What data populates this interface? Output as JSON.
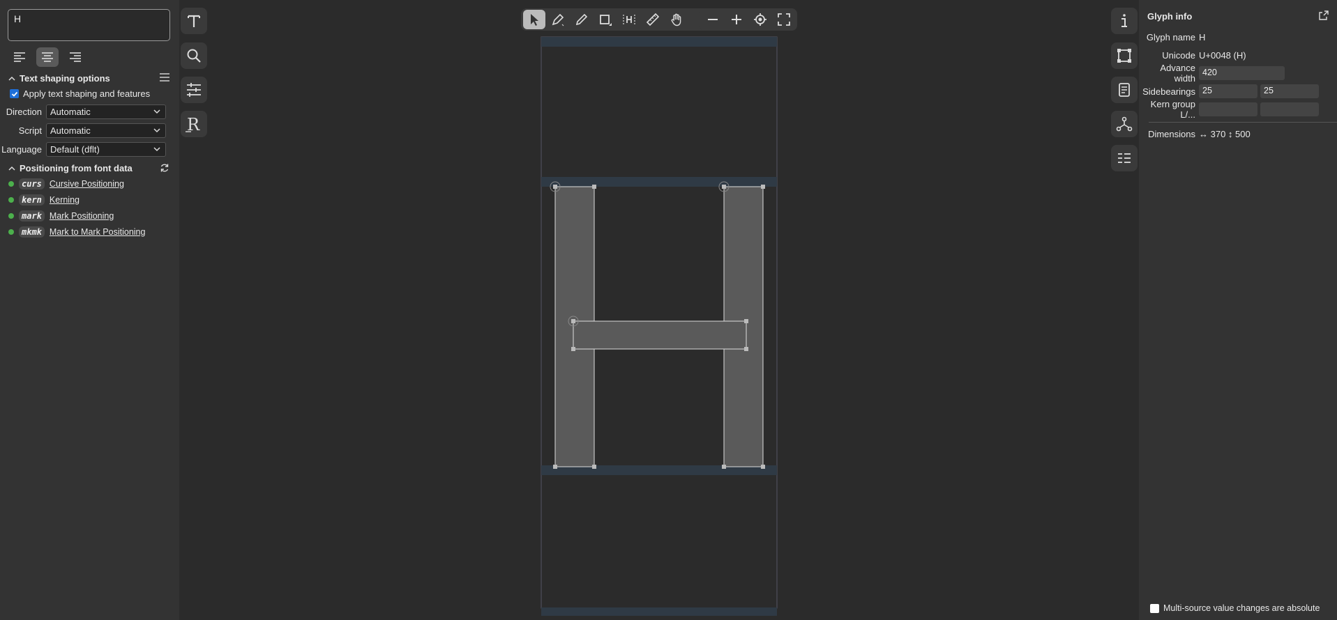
{
  "text_entry": {
    "value": "H"
  },
  "text_shaping": {
    "title": "Text shaping options",
    "apply_label": "Apply text shaping and features",
    "direction_label": "Direction",
    "direction_value": "Automatic",
    "script_label": "Script",
    "script_value": "Automatic",
    "language_label": "Language",
    "language_value": "Default (dflt)"
  },
  "positioning": {
    "title": "Positioning from font data",
    "features": [
      {
        "tag": "curs",
        "name": "Cursive Positioning"
      },
      {
        "tag": "kern",
        "name": "Kerning"
      },
      {
        "tag": "mark",
        "name": "Mark Positioning"
      },
      {
        "tag": "mkmk",
        "name": "Mark to Mark Positioning"
      }
    ]
  },
  "glyph_info": {
    "title": "Glyph info",
    "glyph_name_label": "Glyph name",
    "glyph_name": "H",
    "unicode_label": "Unicode",
    "unicode": "U+0048 (H)",
    "advance_label": "Advance width",
    "advance": "420",
    "sidebearings_label": "Sidebearings",
    "sidebearing_left": "25",
    "sidebearing_right": "25",
    "kern_group_label": "Kern group L/...",
    "kern_left": "",
    "kern_right": "",
    "dimensions_label": "Dimensions",
    "dimensions": "↔ 370 ↕ 500"
  },
  "multi_source_label": "Multi-source value changes are absolute",
  "colors": {
    "accent": "#1e6fd9",
    "feature_dot": "#4cb04c",
    "glyph_fill": "#5a5a5a"
  }
}
